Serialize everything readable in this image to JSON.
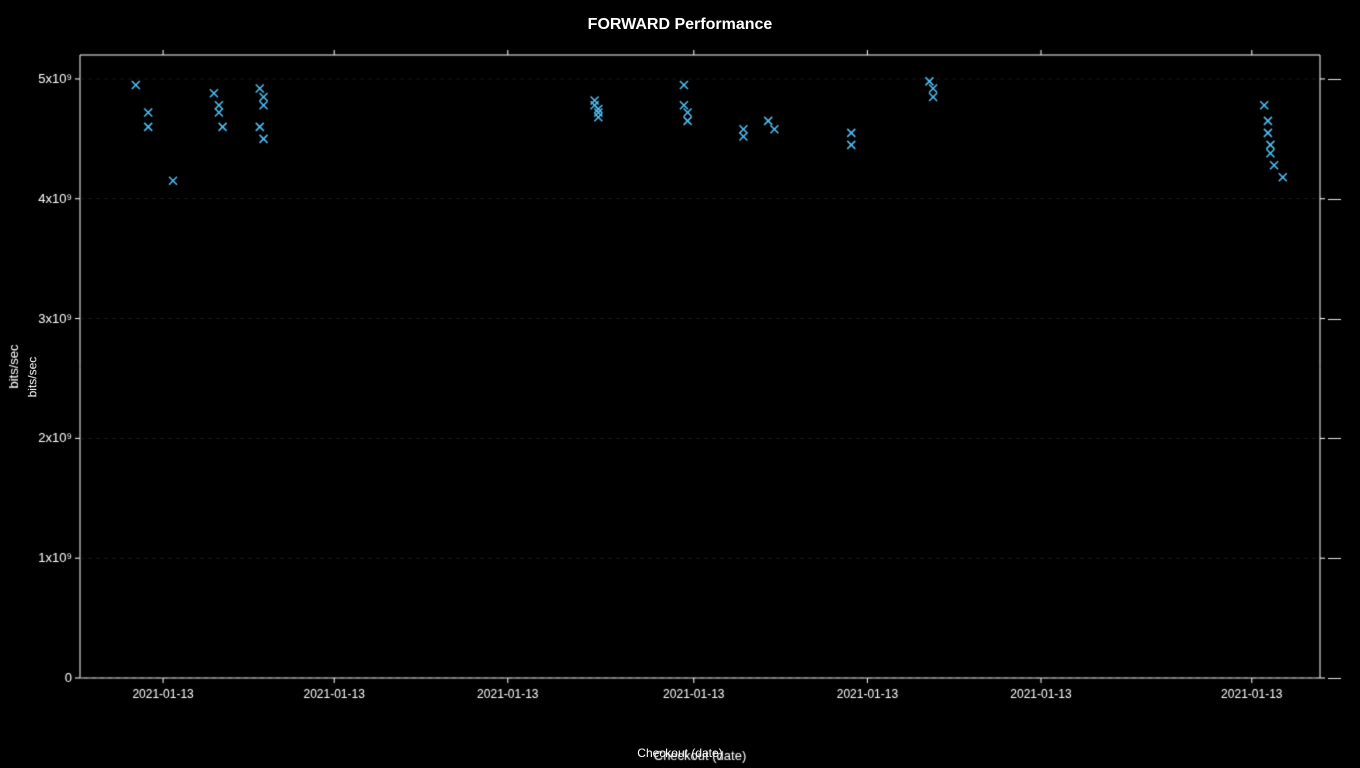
{
  "chart": {
    "title": "FORWARD Performance",
    "x_axis_label": "Checkout (date)",
    "y_axis_label": "bits/sec",
    "y_ticks": [
      {
        "label": "0",
        "value": 0
      },
      {
        "label": "1x10⁹",
        "value": 1000000000
      },
      {
        "label": "2x10⁹",
        "value": 2000000000
      },
      {
        "label": "3x10⁹",
        "value": 3000000000
      },
      {
        "label": "4x10⁹",
        "value": 4000000000
      },
      {
        "label": "5x10⁹",
        "value": 5000000000
      }
    ],
    "x_ticks": [
      "2021-01-13",
      "2021-01-13",
      "2021-01-13",
      "2021-01-13",
      "2021-01-13",
      "2021-01-13",
      "2021-01-13"
    ],
    "data_points": [
      {
        "x_norm": 0.045,
        "y": 4950000000.0
      },
      {
        "x_norm": 0.055,
        "y": 4720000000.0
      },
      {
        "x_norm": 0.055,
        "y": 4600000000.0
      },
      {
        "x_norm": 0.075,
        "y": 4150000000.0
      },
      {
        "x_norm": 0.108,
        "y": 4880000000.0
      },
      {
        "x_norm": 0.112,
        "y": 4780000000.0
      },
      {
        "x_norm": 0.112,
        "y": 4720000000.0
      },
      {
        "x_norm": 0.115,
        "y": 4600000000.0
      },
      {
        "x_norm": 0.145,
        "y": 4920000000.0
      },
      {
        "x_norm": 0.148,
        "y": 4850000000.0
      },
      {
        "x_norm": 0.148,
        "y": 4780000000.0
      },
      {
        "x_norm": 0.145,
        "y": 4600000000.0
      },
      {
        "x_norm": 0.148,
        "y": 4500000000.0
      },
      {
        "x_norm": 0.415,
        "y": 4820000000.0
      },
      {
        "x_norm": 0.415,
        "y": 4780000000.0
      },
      {
        "x_norm": 0.418,
        "y": 4750000000.0
      },
      {
        "x_norm": 0.418,
        "y": 4720000000.0
      },
      {
        "x_norm": 0.418,
        "y": 4680000000.0
      },
      {
        "x_norm": 0.487,
        "y": 4950000000.0
      },
      {
        "x_norm": 0.487,
        "y": 4780000000.0
      },
      {
        "x_norm": 0.49,
        "y": 4720000000.0
      },
      {
        "x_norm": 0.49,
        "y": 4650000000.0
      },
      {
        "x_norm": 0.535,
        "y": 4580000000.0
      },
      {
        "x_norm": 0.535,
        "y": 4520000000.0
      },
      {
        "x_norm": 0.555,
        "y": 4650000000.0
      },
      {
        "x_norm": 0.56,
        "y": 4580000000.0
      },
      {
        "x_norm": 0.622,
        "y": 4550000000.0
      },
      {
        "x_norm": 0.622,
        "y": 4450000000.0
      },
      {
        "x_norm": 0.685,
        "y": 4980000000.0
      },
      {
        "x_norm": 0.688,
        "y": 4920000000.0
      },
      {
        "x_norm": 0.688,
        "y": 4850000000.0
      },
      {
        "x_norm": 0.955,
        "y": 4780000000.0
      },
      {
        "x_norm": 0.958,
        "y": 4650000000.0
      },
      {
        "x_norm": 0.958,
        "y": 4550000000.0
      },
      {
        "x_norm": 0.96,
        "y": 4450000000.0
      },
      {
        "x_norm": 0.96,
        "y": 4380000000.0
      },
      {
        "x_norm": 0.963,
        "y": 4280000000.0
      },
      {
        "x_norm": 0.97,
        "y": 4180000000.0
      }
    ]
  }
}
